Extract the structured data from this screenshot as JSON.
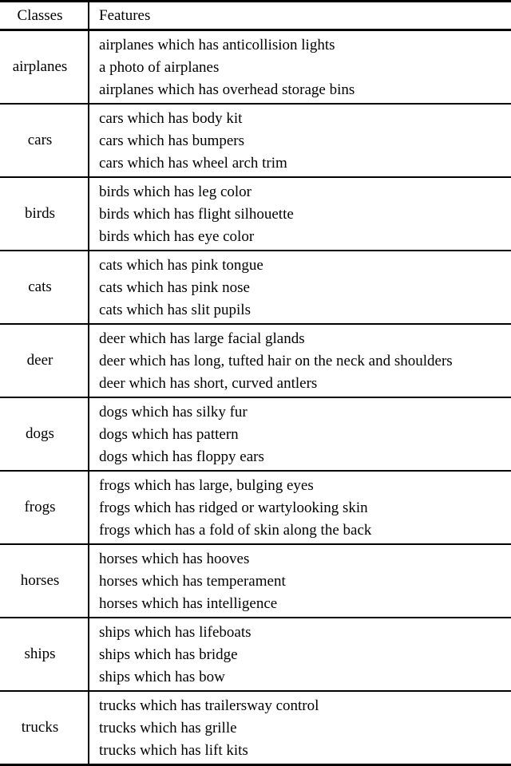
{
  "document": {
    "kind": "academic-table",
    "columns": {
      "classes_header": "Classes",
      "features_header": "Features"
    }
  },
  "rows": [
    {
      "class_label": "airplanes",
      "features": [
        "airplanes which has anticollision lights",
        "a photo of airplanes",
        "airplanes which has overhead storage bins"
      ]
    },
    {
      "class_label": "cars",
      "features": [
        "cars which has body kit",
        "cars which has bumpers",
        "cars which has wheel arch trim"
      ]
    },
    {
      "class_label": "birds",
      "features": [
        "birds which has leg color",
        "birds which has flight silhouette",
        "birds which has eye color"
      ]
    },
    {
      "class_label": "cats",
      "features": [
        "cats which has pink tongue",
        "cats which has pink nose",
        "cats which has slit pupils"
      ]
    },
    {
      "class_label": "deer",
      "features": [
        "deer which has large facial glands",
        "deer which has long, tufted hair on the neck and shoulders",
        "deer which has short, curved antlers"
      ]
    },
    {
      "class_label": "dogs",
      "features": [
        "dogs which has silky fur",
        "dogs which has pattern",
        "dogs which has floppy ears"
      ]
    },
    {
      "class_label": "frogs",
      "features": [
        "frogs which has large, bulging eyes",
        "frogs which has ridged or wartylooking skin",
        "frogs which has a fold of skin along the back"
      ]
    },
    {
      "class_label": "horses",
      "features": [
        "horses which has hooves",
        "horses which has temperament",
        "horses which has intelligence"
      ]
    },
    {
      "class_label": "ships",
      "features": [
        "ships which has lifeboats",
        "ships which has bridge",
        "ships which has bow"
      ]
    },
    {
      "class_label": "trucks",
      "features": [
        "trucks which has trailersway control",
        "trucks which has grille",
        "trucks which has lift kits"
      ]
    }
  ],
  "style": {
    "text_color": "#000000",
    "background": "#ffffff",
    "rule_color": "#000000"
  }
}
